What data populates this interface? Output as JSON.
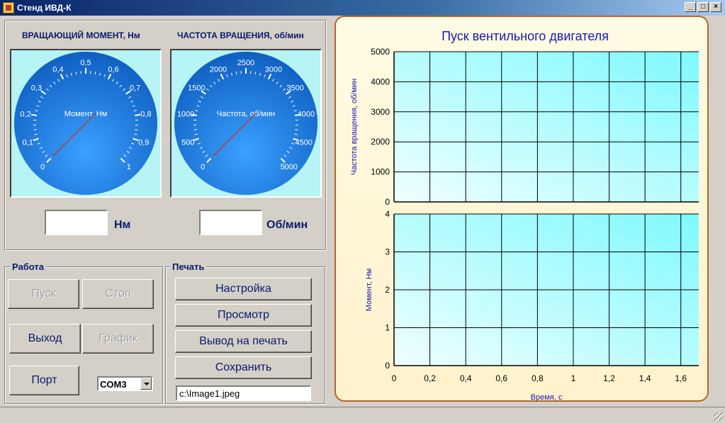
{
  "window": {
    "title": "Стенд ИВД-К",
    "controls": {
      "minimize": "_",
      "restore": "□",
      "close": "×"
    }
  },
  "gauges": {
    "torque": {
      "title": "ВРАЩАЮЩИЙ МОМЕНТ, Нм",
      "dial_label": "Момент, Нм",
      "ticks": [
        "0",
        "0,1",
        "0,2",
        "0,3",
        "0,4",
        "0,5",
        "0,6",
        "0,7",
        "0,8",
        "0,9",
        "1"
      ],
      "value": "",
      "unit": "Нм"
    },
    "speed": {
      "title": "ЧАСТОТА ВРАЩЕНИЯ, об/мин",
      "dial_label": "Частота, об/мин",
      "ticks": [
        "0",
        "500",
        "1000",
        "1500",
        "2000",
        "2500",
        "3000",
        "3500",
        "4000",
        "4500",
        "5000"
      ],
      "value": "",
      "unit": "Об/мин"
    }
  },
  "work_group": {
    "label": "Работа",
    "start": "Пуск",
    "stop": "Стоп",
    "exit": "Выход",
    "graph": "График",
    "port": "Порт",
    "port_select": "COM3"
  },
  "print_group": {
    "label": "Печать",
    "setup": "Настройка",
    "preview": "Просмотр",
    "print": "Вывод на печать",
    "save": "Сохранить",
    "file_path": "c:\\Image1.jpeg"
  },
  "colors": {
    "accent_text": "#0a1a6a",
    "gauge_face": "#1e7fe6",
    "frame_border": "#b5662b"
  },
  "chart_data": [
    {
      "type": "line",
      "title": "Пуск вентильного двигателя",
      "ylabel": "Частота вращения, об/мин",
      "ylim": [
        0,
        5000
      ],
      "y_ticks": [
        "0",
        "1000",
        "2000",
        "3000",
        "4000",
        "5000"
      ],
      "xlim": [
        0,
        1.7
      ],
      "grid": true,
      "series": []
    },
    {
      "type": "line",
      "ylabel": "Момент, Нм",
      "xlabel": "Время, с",
      "ylim": [
        0,
        4
      ],
      "y_ticks": [
        "0",
        "1",
        "2",
        "3",
        "4"
      ],
      "x_ticks": [
        "0",
        "0,2",
        "0,4",
        "0,6",
        "0,8",
        "1",
        "1,2",
        "1,4",
        "1,6"
      ],
      "xlim": [
        0,
        1.7
      ],
      "grid": true,
      "series": []
    }
  ]
}
